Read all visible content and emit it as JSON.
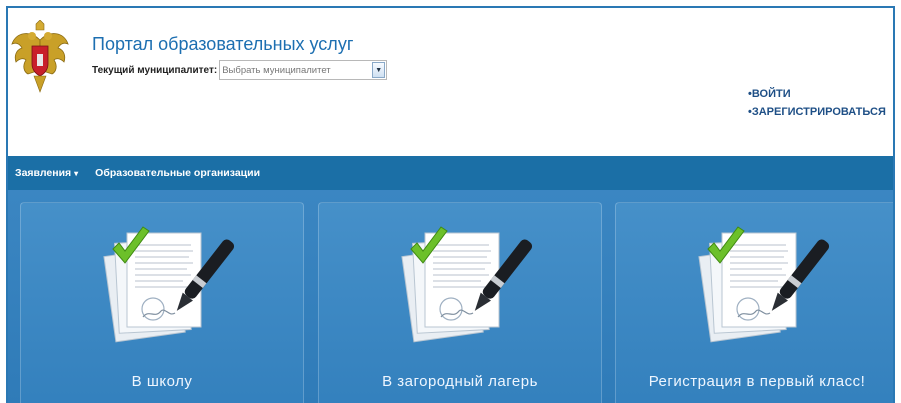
{
  "header": {
    "portal_title": "Портал образовательных услуг",
    "municipality_label": "Текущий муниципалитет:",
    "municipality_select": {
      "selected": "Выбрать муниципалитет"
    },
    "auth_links": [
      "•ВОЙТИ",
      "•ЗАРЕГИСТРИРОВАТЬСЯ"
    ]
  },
  "nav": {
    "items": [
      {
        "label": "Заявления",
        "has_dropdown": true,
        "caret": "▾"
      },
      {
        "label": "Образовательные организации",
        "has_dropdown": false
      }
    ]
  },
  "tiles": [
    {
      "label": "В школу",
      "icon": "documents-pen-check-icon"
    },
    {
      "label": "В загородный лагерь",
      "icon": "documents-pen-check-icon"
    },
    {
      "label": "Регистрация в первый класс!",
      "icon": "documents-pen-check-icon"
    }
  ],
  "colors": {
    "brand_blue": "#1d6fb1",
    "nav_bg": "#1b6fa6",
    "tiles_bg": "#3b86c2",
    "auth_link": "#1e4f86",
    "check_green": "#6cc02a"
  }
}
